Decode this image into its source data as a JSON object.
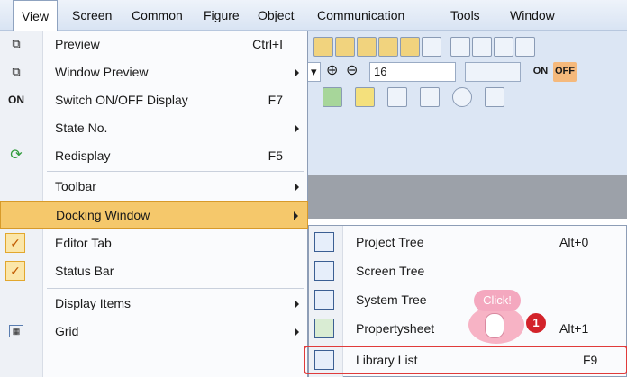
{
  "menubar": {
    "items": [
      {
        "label": "View"
      },
      {
        "label": "Screen"
      },
      {
        "label": "Common"
      },
      {
        "label": "Figure"
      },
      {
        "label": "Object"
      },
      {
        "label": "Communication"
      },
      {
        "label": "Tools"
      },
      {
        "label": "Window"
      }
    ]
  },
  "toolbar": {
    "font_size_value": "16",
    "on_label": "ON",
    "off_label": "OFF"
  },
  "view_menu": {
    "items": [
      {
        "label": "Preview",
        "shortcut": "Ctrl+I",
        "icon": "preview-icon"
      },
      {
        "label": "Window Preview",
        "icon": "window-preview-icon"
      },
      {
        "label": "Switch ON/OFF Display",
        "shortcut": "F7",
        "icon_text": "ON"
      },
      {
        "label": "State No."
      },
      {
        "label": "Redisplay",
        "shortcut": "F5",
        "icon": "refresh-icon"
      },
      {
        "label": "Toolbar"
      },
      {
        "label": "Docking Window"
      },
      {
        "label": "Editor Tab"
      },
      {
        "label": "Status Bar"
      },
      {
        "label": "Display Items"
      },
      {
        "label": "Grid",
        "icon": "grid-icon"
      }
    ]
  },
  "docking_submenu": {
    "items": [
      {
        "label": "Project Tree",
        "shortcut": "Alt+0"
      },
      {
        "label": "Screen Tree",
        "shortcut": ""
      },
      {
        "label": "System Tree",
        "shortcut": ""
      },
      {
        "label": "Propertysheet",
        "shortcut": "Alt+1"
      },
      {
        "label": "Library List",
        "shortcut": "F9"
      }
    ]
  },
  "callout": {
    "text": "Click!",
    "step": "1"
  },
  "colors": {
    "highlight": "#f5c86b",
    "target_border": "#e03b3b",
    "callout_pink": "#f4a8bf",
    "step_red": "#d3232a"
  }
}
